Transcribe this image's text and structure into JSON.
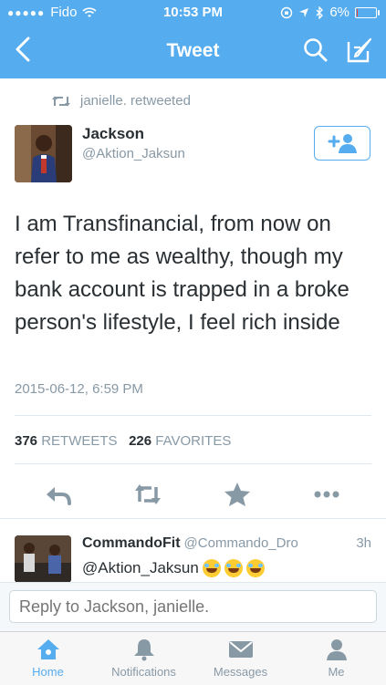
{
  "status_bar": {
    "carrier": "Fido",
    "time": "10:53 PM",
    "battery": "6%",
    "battery_level": 0.06
  },
  "nav": {
    "title": "Tweet"
  },
  "retweet_context": "janielle. retweeted",
  "tweet": {
    "author_name": "Jackson",
    "author_handle": "@Aktion_Jaksun",
    "text": "I am Transfinancial, from now on refer to me as wealthy, though my bank account is trapped in a broke person's lifestyle, I feel rich inside",
    "timestamp": "2015-06-12, 6:59 PM",
    "retweets_count": "376",
    "retweets_label": "RETWEETS",
    "favorites_count": "226",
    "favorites_label": "FAVORITES"
  },
  "reply": {
    "name": "CommandoFit",
    "handle": "@Commando_Dro",
    "time": "3h",
    "text": "@Aktion_Jaksun",
    "emoji": [
      "face-with-tears-of-joy",
      "face-with-tears-of-joy",
      "face-with-tears-of-joy"
    ]
  },
  "composer": {
    "placeholder": "Reply to Jackson, janielle."
  },
  "tabs": [
    {
      "label": "Home",
      "icon": "home-icon",
      "active": true
    },
    {
      "label": "Notifications",
      "icon": "bell-icon",
      "active": false
    },
    {
      "label": "Messages",
      "icon": "envelope-icon",
      "active": false
    },
    {
      "label": "Me",
      "icon": "person-icon",
      "active": false
    }
  ],
  "colors": {
    "brand": "#55acee",
    "text": "#292f33",
    "muted": "#8899a6",
    "action_icon": "#8899a6"
  }
}
